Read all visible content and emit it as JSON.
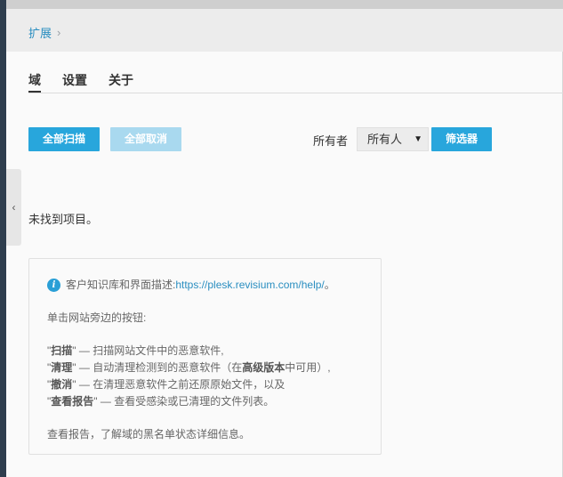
{
  "breadcrumb": {
    "item": "扩展",
    "separator": "›"
  },
  "tabs": [
    {
      "label": "域"
    },
    {
      "label": "设置"
    },
    {
      "label": "关于"
    }
  ],
  "toolbar": {
    "scan_all": "全部扫描",
    "cancel_all": "全部取消",
    "owner_label": "所有者",
    "owner_value": "所有人",
    "filter": "筛选器"
  },
  "empty_message": "未找到项目。",
  "info": {
    "kb_prefix": "客户知识库和界面描述:",
    "kb_link": "https://plesk.revisium.com/help/",
    "kb_suffix": "。",
    "intro": "单击网站旁边的按钮:",
    "items": [
      {
        "pre": "\"",
        "term": "扫描",
        "post": "\" — 扫描网站文件中的恶意软件,",
        "pre2": "",
        "term2": "",
        "post2": ""
      },
      {
        "pre": "\"",
        "term": "清理",
        "post": "\" — 自动清理检测到的恶意软件（在",
        "pre2": "",
        "term2": "高级版本",
        "post2": "中可用）,"
      },
      {
        "pre": "\"",
        "term": "撤消",
        "post": "\" — 在清理恶意软件之前还原原始文件，以及",
        "pre2": "",
        "term2": "",
        "post2": ""
      },
      {
        "pre": "\"",
        "term": "查看报告",
        "post": "\" — 查看受感染或已清理的文件列表。",
        "pre2": "",
        "term2": "",
        "post2": ""
      }
    ],
    "footer": "查看报告，了解域的黑名单状态详细信息。"
  },
  "icons": {
    "collapse": "chevron-left-icon",
    "info": "info-icon",
    "dropdown": "caret-down-icon"
  },
  "colors": {
    "primary": "#28a6dc",
    "primary_disabled": "#a9d9ef",
    "link": "#2a8ec0",
    "sidebar": "#2f3e4e"
  }
}
